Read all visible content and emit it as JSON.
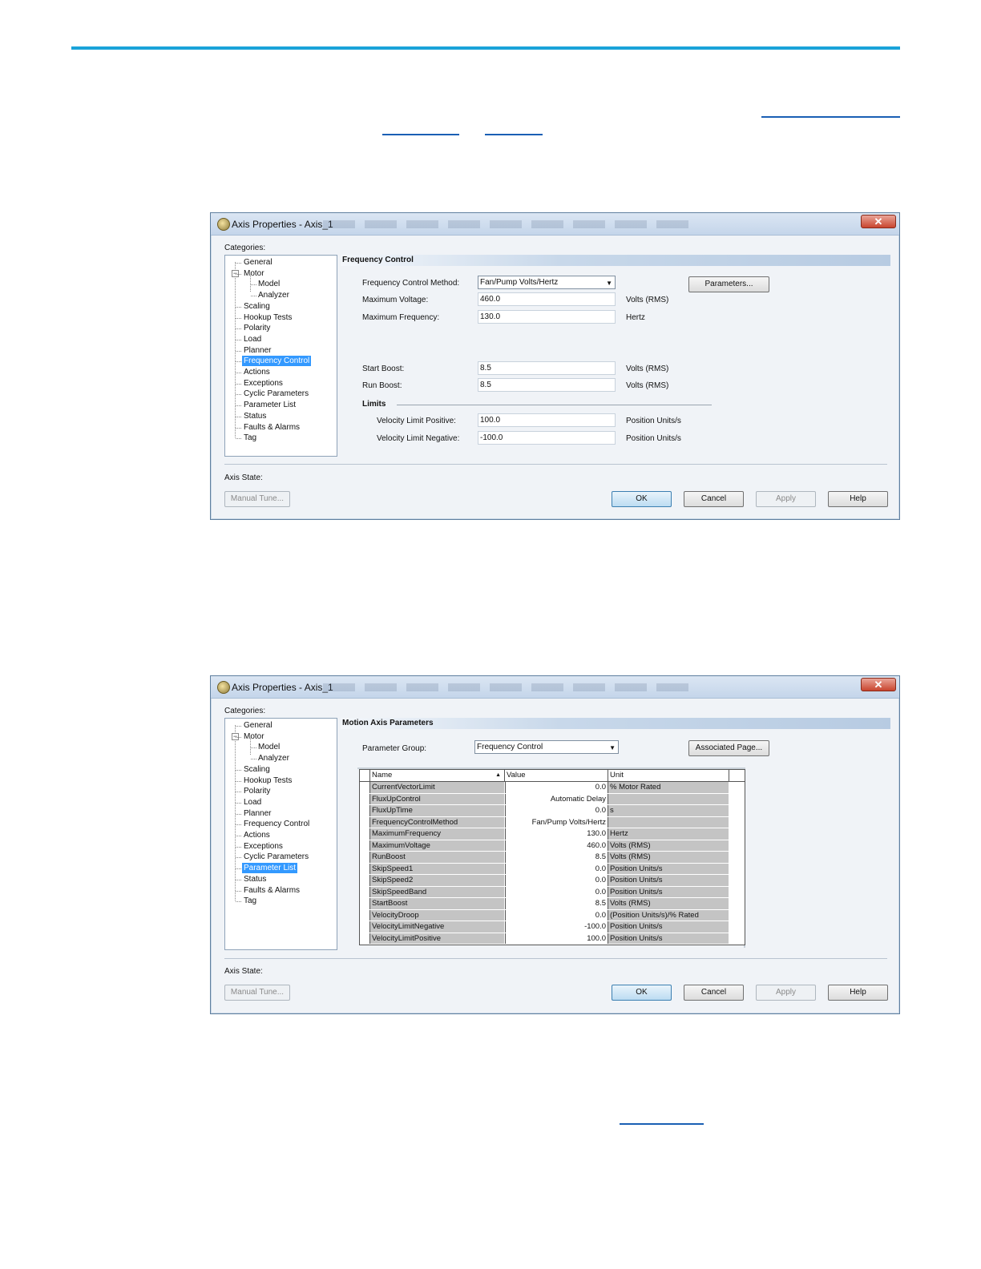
{
  "dialog1": {
    "title": "Axis Properties - Axis_1",
    "categories_label": "Categories:",
    "tree": [
      {
        "label": "General",
        "level": 0
      },
      {
        "label": "Motor",
        "level": 0
      },
      {
        "label": "Model",
        "level": 1
      },
      {
        "label": "Analyzer",
        "level": 1
      },
      {
        "label": "Scaling",
        "level": 0
      },
      {
        "label": "Hookup Tests",
        "level": 0
      },
      {
        "label": "Polarity",
        "level": 0
      },
      {
        "label": "Load",
        "level": 0
      },
      {
        "label": "Planner",
        "level": 0
      },
      {
        "label": "Frequency Control",
        "level": 0
      },
      {
        "label": "Actions",
        "level": 0
      },
      {
        "label": "Exceptions",
        "level": 0
      },
      {
        "label": "Cyclic Parameters",
        "level": 0
      },
      {
        "label": "Parameter List",
        "level": 0
      },
      {
        "label": "Status",
        "level": 0
      },
      {
        "label": "Faults & Alarms",
        "level": 0
      },
      {
        "label": "Tag",
        "level": 0
      }
    ],
    "selected_category": "Frequency Control",
    "section_title": "Frequency Control",
    "method_label": "Frequency Control Method:",
    "method_value": "Fan/Pump Volts/Hertz",
    "parameters_button": "Parameters...",
    "max_voltage_label": "Maximum Voltage:",
    "max_voltage_value": "460.0",
    "max_voltage_unit": "Volts (RMS)",
    "max_freq_label": "Maximum Frequency:",
    "max_freq_value": "130.0",
    "max_freq_unit": "Hertz",
    "start_boost_label": "Start Boost:",
    "start_boost_value": "8.5",
    "start_boost_unit": "Volts (RMS)",
    "run_boost_label": "Run Boost:",
    "run_boost_value": "8.5",
    "run_boost_unit": "Volts (RMS)",
    "limits_label": "Limits",
    "vel_pos_label": "Velocity Limit Positive:",
    "vel_pos_value": "100.0",
    "vel_pos_unit": "Position Units/s",
    "vel_neg_label": "Velocity Limit Negative:",
    "vel_neg_value": "-100.0",
    "vel_neg_unit": "Position Units/s",
    "axis_state_label": "Axis State:",
    "manual_tune": "Manual Tune...",
    "ok": "OK",
    "cancel": "Cancel",
    "apply": "Apply",
    "help": "Help"
  },
  "dialog2": {
    "title": "Axis Properties - Axis_1",
    "categories_label": "Categories:",
    "selected_category": "Parameter List",
    "section_title": "Motion Axis Parameters",
    "param_group_label": "Parameter Group:",
    "param_group_value": "Frequency Control",
    "associated_page_button": "Associated Page...",
    "columns": [
      "Name",
      "Value",
      "Unit"
    ],
    "rows": [
      {
        "name": "CurrentVectorLimit",
        "value": "0.0",
        "unit": "% Motor Rated"
      },
      {
        "name": "FluxUpControl",
        "value": "Automatic Delay",
        "unit": ""
      },
      {
        "name": "FluxUpTime",
        "value": "0.0",
        "unit": "s"
      },
      {
        "name": "FrequencyControlMethod",
        "value": "Fan/Pump Volts/Hertz",
        "unit": ""
      },
      {
        "name": "MaximumFrequency",
        "value": "130.0",
        "unit": "Hertz"
      },
      {
        "name": "MaximumVoltage",
        "value": "460.0",
        "unit": "Volts (RMS)"
      },
      {
        "name": "RunBoost",
        "value": "8.5",
        "unit": "Volts (RMS)"
      },
      {
        "name": "SkipSpeed1",
        "value": "0.0",
        "unit": "Position Units/s"
      },
      {
        "name": "SkipSpeed2",
        "value": "0.0",
        "unit": "Position Units/s"
      },
      {
        "name": "SkipSpeedBand",
        "value": "0.0",
        "unit": "Position Units/s"
      },
      {
        "name": "StartBoost",
        "value": "8.5",
        "unit": "Volts (RMS)"
      },
      {
        "name": "VelocityDroop",
        "value": "0.0",
        "unit": "(Position Units/s)/% Rated"
      },
      {
        "name": "VelocityLimitNegative",
        "value": "-100.0",
        "unit": "Position Units/s"
      },
      {
        "name": "VelocityLimitPositive",
        "value": "100.0",
        "unit": "Position Units/s"
      }
    ],
    "axis_state_label": "Axis State:",
    "manual_tune": "Manual Tune...",
    "ok": "OK",
    "cancel": "Cancel",
    "apply": "Apply",
    "help": "Help"
  },
  "colors": {
    "accent_rule": "#1aa3d9",
    "selection": "#3399ff",
    "close_button": "#c9452f"
  }
}
